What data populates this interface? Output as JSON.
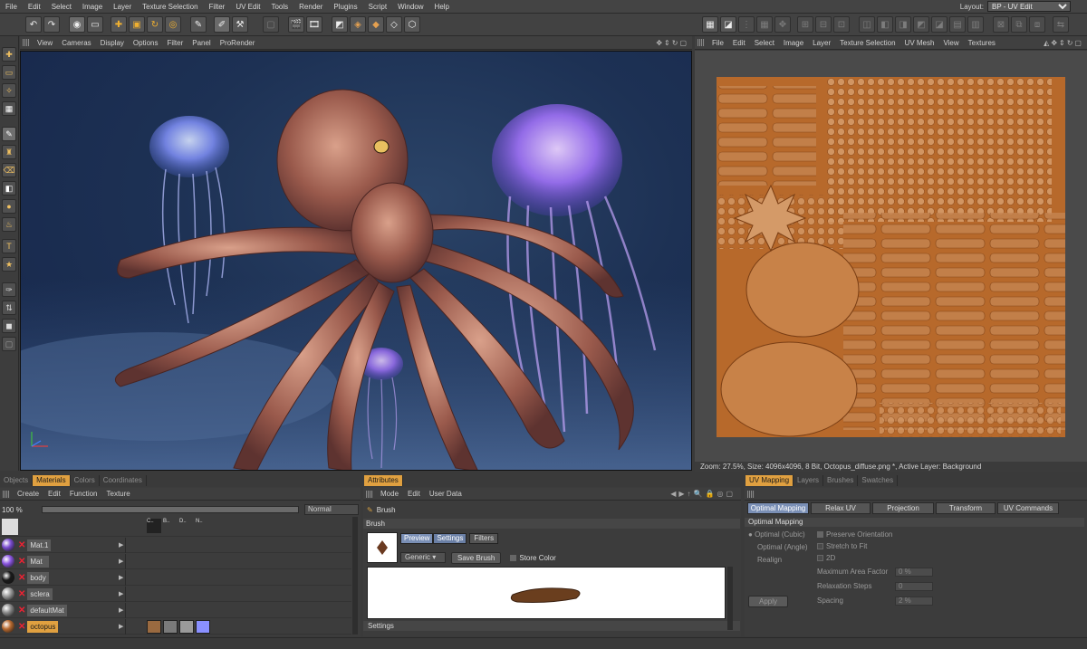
{
  "menu": [
    "File",
    "Edit",
    "Select",
    "Image",
    "Layer",
    "Texture Selection",
    "Filter",
    "UV Edit",
    "Tools",
    "Render",
    "Plugins",
    "Script",
    "Window",
    "Help"
  ],
  "layout": {
    "label": "Layout:",
    "value": "BP - UV Edit"
  },
  "viewport": {
    "menu": [
      "View",
      "Cameras",
      "Display",
      "Options",
      "Filter",
      "Panel",
      "ProRender"
    ]
  },
  "uv": {
    "menu": [
      "File",
      "Edit",
      "Select",
      "Image",
      "Layer",
      "Texture Selection",
      "UV Mesh",
      "View",
      "Textures"
    ],
    "status": "Zoom: 27.5%, Size: 4096x4096, 8 Bit, Octopus_diffuse.png *, Active Layer: Background"
  },
  "materials": {
    "tabs": [
      "Objects",
      "Materials",
      "Colors",
      "Coordinates"
    ],
    "menu": [
      "Create",
      "Edit",
      "Function",
      "Texture"
    ],
    "zoom": "100 %",
    "blend": "Normal",
    "channels": [
      "C..",
      "B..",
      "D..",
      "N.."
    ],
    "items": [
      {
        "name": "Mat.1",
        "color": "#7a4cd0"
      },
      {
        "name": "Mat",
        "color": "#8a55e0"
      },
      {
        "name": "body",
        "color": "#1a1a1a"
      },
      {
        "name": "sclera",
        "color": "#9a9a9a"
      },
      {
        "name": "defaultMat",
        "color": "#8a8a8a"
      },
      {
        "name": "octopus",
        "color": "#b86a30"
      }
    ]
  },
  "attributes": {
    "tab": "Attributes",
    "menu": [
      "Mode",
      "Edit",
      "User Data"
    ],
    "title": "Brush",
    "section": "Brush",
    "subtabs": [
      "Preview",
      "Settings",
      "Filters"
    ],
    "preset": "Generic",
    "save_brush": "Save Brush",
    "store_color": "Store Color",
    "footer": "Settings"
  },
  "uvmapping": {
    "tabs": [
      "UV Mapping",
      "Layers",
      "Brushes",
      "Swatches"
    ],
    "buttons": [
      "Optimal Mapping",
      "Relax UV",
      "Projection",
      "Transform",
      "UV Commands"
    ],
    "section": "Optimal Mapping",
    "radios": [
      "Optimal (Cubic)",
      "Optimal (Angle)",
      "Realign"
    ],
    "checks": [
      {
        "label": "Preserve Orientation",
        "on": true
      },
      {
        "label": "Stretch to Fit",
        "on": false
      },
      {
        "label": "2D",
        "on": false
      }
    ],
    "fields": [
      {
        "label": "Maximum Area Factor",
        "value": "0 %"
      },
      {
        "label": "Relaxation Steps",
        "value": "0"
      },
      {
        "label": "Spacing",
        "value": "2 %"
      }
    ],
    "apply": "Apply"
  },
  "colors": {
    "accent": "#e0a040",
    "texture": "#b7692b"
  }
}
